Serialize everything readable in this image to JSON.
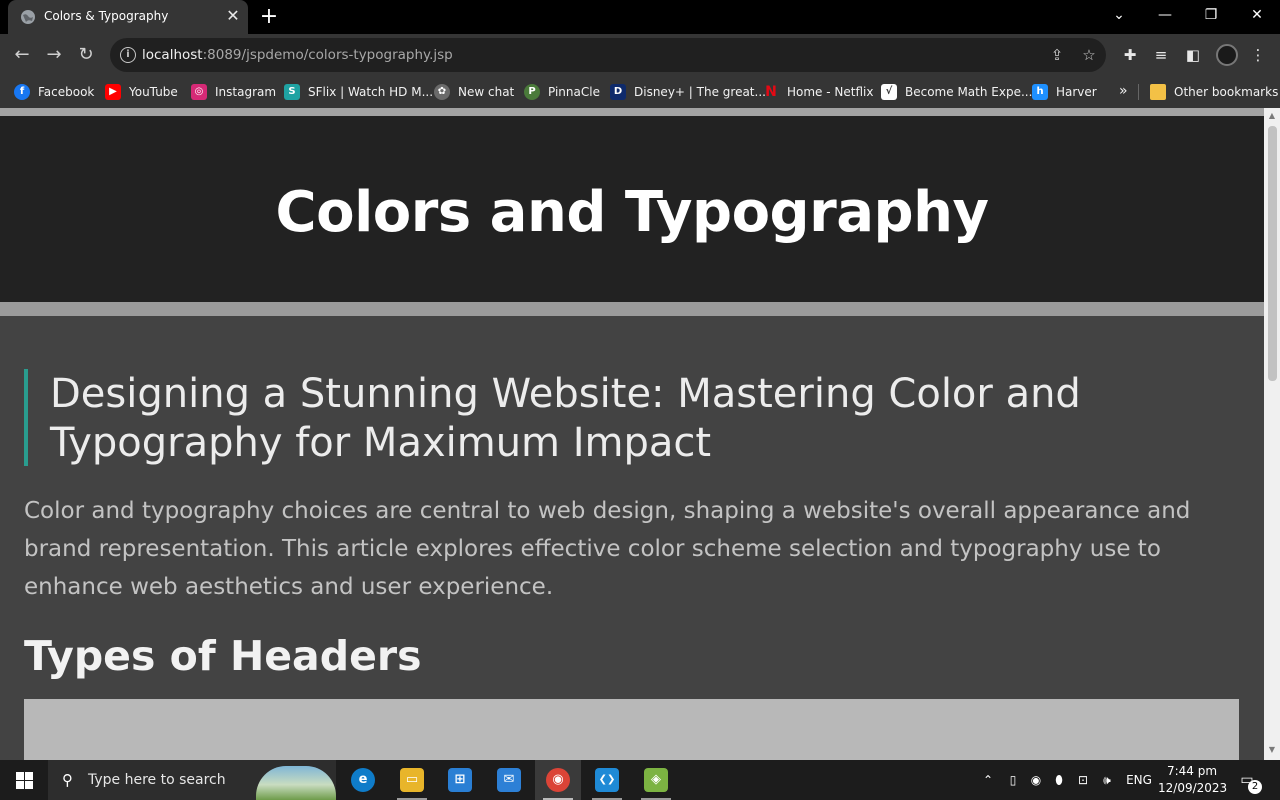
{
  "browser": {
    "tab_title": "Colors & Typography",
    "tab_close": "✕",
    "new_tab": "+",
    "url_host": "localhost",
    "url_rest": ":8089/jspdemo/colors-typography.jsp",
    "window_controls": {
      "minimize": "—",
      "restore": "❐",
      "close": "✕",
      "tab_search": "⌄"
    }
  },
  "bookmarks": [
    {
      "label": "Facebook",
      "icon": "facebook-icon",
      "color": "#1877f2",
      "glyph": "f"
    },
    {
      "label": "YouTube",
      "icon": "youtube-icon",
      "color": "#ff0000",
      "glyph": "▶"
    },
    {
      "label": "Instagram",
      "icon": "instagram-icon",
      "color": "#d62976",
      "glyph": "◎"
    },
    {
      "label": "SFlix | Watch HD M...",
      "icon": "sflix-icon",
      "color": "#1fa3a3",
      "glyph": "S"
    },
    {
      "label": "New chat",
      "icon": "chatgpt-icon",
      "color": "#6a6a6a",
      "glyph": "✿"
    },
    {
      "label": "PinnaCle",
      "icon": "pinnacle-icon",
      "color": "#4a7a3a",
      "glyph": "P"
    },
    {
      "label": "Disney+ | The great...",
      "icon": "disney-icon",
      "color": "#0e2a6b",
      "glyph": "D"
    },
    {
      "label": "Home - Netflix",
      "icon": "netflix-icon",
      "color": "#e50914",
      "glyph": "N"
    },
    {
      "label": "Become Math Expe...",
      "icon": "math-icon",
      "color": "#ffffff",
      "glyph": "√"
    },
    {
      "label": "Harver",
      "icon": "harver-icon",
      "color": "#1e90ff",
      "glyph": "h"
    }
  ],
  "bookmarks_overflow": "»",
  "other_bookmarks": "Other bookmarks",
  "page": {
    "hero_title": "Colors and Typography",
    "article_title": "Designing a Stunning Website: Mastering Color and Typography for Maximum Impact",
    "intro": "Color and typography choices are central to web design, shaping a website's overall appearance and brand representation. This article explores effective color scheme selection and typography use to enhance web aesthetics and user experience.",
    "section_heading": "Types of Headers"
  },
  "colors": {
    "hero_bg": "#222222",
    "page_bg": "#434343",
    "accent_bar": "#2a9d8f"
  },
  "taskbar": {
    "search_placeholder": "Type here to search",
    "language": "ENG",
    "time": "7:44 pm",
    "date": "12/09/2023",
    "notification_count": "2",
    "apps": [
      {
        "name": "edge-icon",
        "glyph": "e",
        "color": "#0f7cc9"
      },
      {
        "name": "file-explorer-icon",
        "glyph": "▭",
        "color": "#e8b52a"
      },
      {
        "name": "store-icon",
        "glyph": "⊞",
        "color": "#2a7fd4"
      },
      {
        "name": "mail-icon",
        "glyph": "✉",
        "color": "#2d80d6"
      },
      {
        "name": "chrome-icon",
        "glyph": "◉",
        "color": "#db4437"
      },
      {
        "name": "vscode-icon",
        "glyph": "❮❯",
        "color": "#1f8ad6"
      },
      {
        "name": "android-studio-icon",
        "glyph": "◈",
        "color": "#7cb342"
      }
    ]
  }
}
